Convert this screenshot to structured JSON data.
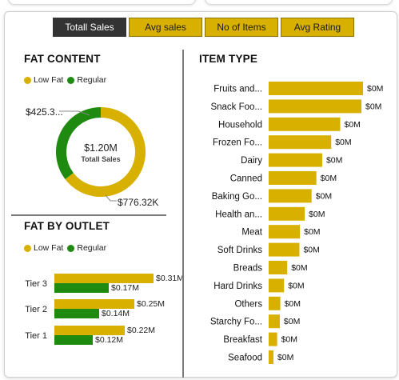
{
  "tabs": [
    {
      "label": "Totall Sales",
      "active": true
    },
    {
      "label": "Avg sales",
      "active": false
    },
    {
      "label": "No of Items",
      "active": false
    },
    {
      "label": "Avg Rating",
      "active": false
    }
  ],
  "colors": {
    "low_fat": "#d7b000",
    "regular": "#1f8a10",
    "active_tab": "#333333",
    "accent": "#d7b000"
  },
  "fat_content": {
    "title": "FAT CONTENT",
    "legend": [
      "Low Fat",
      "Regular"
    ],
    "center_value": "$1.20M",
    "center_label": "Totall Sales",
    "label_regular": "$425.3...",
    "label_lowfat": "$776.32K"
  },
  "fat_by_outlet": {
    "title": "FAT BY OUTLET",
    "legend": [
      "Low Fat",
      "Regular"
    ]
  },
  "item_type": {
    "title": "ITEM TYPE"
  },
  "chart_data": [
    {
      "type": "pie",
      "donut": true,
      "categories": [
        "Low Fat",
        "Regular"
      ],
      "values": [
        776.32,
        425.3
      ],
      "unit": "K"
    },
    {
      "type": "bar",
      "orientation": "horizontal",
      "categories": [
        "Tier 3",
        "Tier 2",
        "Tier 1"
      ],
      "series": [
        {
          "name": "Low Fat",
          "values": [
            0.31,
            0.25,
            0.22
          ],
          "labels": [
            "$0.31M",
            "$0.25M",
            "$0.22M"
          ]
        },
        {
          "name": "Regular",
          "values": [
            0.17,
            0.14,
            0.12
          ],
          "labels": [
            "$0.17M",
            "$0.14M",
            "$0.12M"
          ]
        }
      ]
    },
    {
      "type": "bar",
      "orientation": "horizontal",
      "categories": [
        "Fruits and...",
        "Snack Foo...",
        "Household",
        "Frozen Fo...",
        "Dairy",
        "Canned",
        "Baking Go...",
        "Health an...",
        "Meat",
        "Soft Drinks",
        "Breads",
        "Hard Drinks",
        "Others",
        "Starchy Fo...",
        "Breakfast",
        "Seafood"
      ],
      "values": [
        0.178,
        0.175,
        0.135,
        0.118,
        0.101,
        0.09,
        0.081,
        0.068,
        0.059,
        0.058,
        0.035,
        0.029,
        0.022,
        0.021,
        0.016,
        0.009
      ],
      "labels": [
        "$0M",
        "$0M",
        "$0M",
        "$0M",
        "$0M",
        "$0M",
        "$0M",
        "$0M",
        "$0M",
        "$0M",
        "$0M",
        "$0M",
        "$0M",
        "$0M",
        "$0M",
        "$0M"
      ]
    }
  ]
}
